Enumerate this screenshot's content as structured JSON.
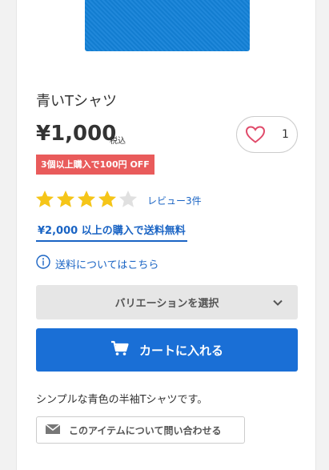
{
  "product": {
    "title": "青いTシャツ",
    "price": "¥1,000",
    "tax_label": "税込",
    "favorite_count": "1",
    "discount_badge": "3個以上購入で100円 OFF",
    "rating_stars": 4,
    "rating_max": 5,
    "review_link": "レビュー3件",
    "shipping_note": "¥2,000 以上の購入で送料無料",
    "shipping_info_link": "送料についてはこちら",
    "variation_select": "バリエーションを選択",
    "add_to_cart": "カートに入れる",
    "description": "シンプルな青色の半袖Tシャツです。",
    "inquiry_button": "このアイテムについて問い合わせる"
  },
  "colors": {
    "product_image": "#1482d8",
    "accent_blue": "#1a6fd6",
    "star_filled": "#f5c518",
    "star_empty": "#e0e0e0",
    "discount_badge": "#e95b5b"
  }
}
